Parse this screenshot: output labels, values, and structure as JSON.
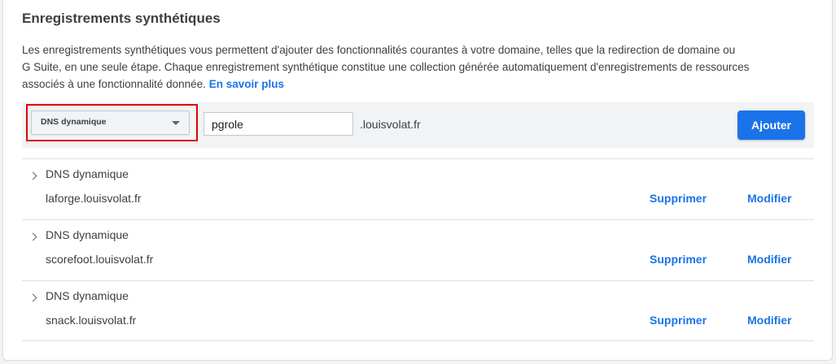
{
  "section": {
    "title": "Enregistrements synthétiques",
    "description_line1": "Les enregistrements synthétiques vous permettent d'ajouter des fonctionnalités courantes à votre domaine, telles que la redirection de domaine ou",
    "description_line2": "G Suite, en une seule étape. Chaque enregistrement synthétique constitue une collection générée automatiquement d'enregistrements de ressources",
    "description_line3": "associés à une fonctionnalité donnée.",
    "learn_more": "En savoir plus"
  },
  "add_bar": {
    "type_select_value": "DNS dynamique",
    "host_input_value": "pgrole",
    "domain_suffix": ".louisvolat.fr",
    "add_button": "Ajouter"
  },
  "records": [
    {
      "type": "DNS dynamique",
      "domain": "laforge.louisvolat.fr",
      "delete": "Supprimer",
      "edit": "Modifier"
    },
    {
      "type": "DNS dynamique",
      "domain": "scorefoot.louisvolat.fr",
      "delete": "Supprimer",
      "edit": "Modifier"
    },
    {
      "type": "DNS dynamique",
      "domain": "snack.louisvolat.fr",
      "delete": "Supprimer",
      "edit": "Modifier"
    }
  ],
  "colors": {
    "accent": "#1a73e8",
    "highlight_border": "#e00000"
  },
  "icons": {
    "select_caret": "chevron-down-icon",
    "row_expand": "chevron-right-icon"
  }
}
